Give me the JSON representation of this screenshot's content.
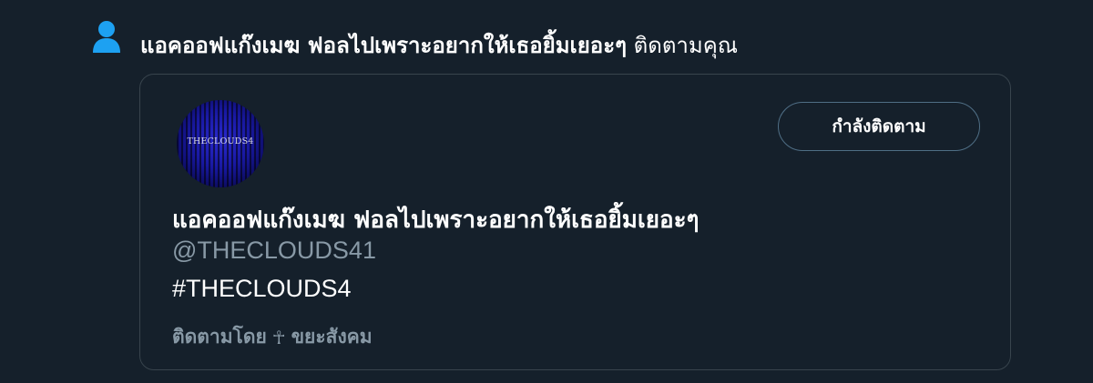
{
  "notification": {
    "icon": "person-icon",
    "actor_name": "แอคออฟแก๊งเมฆ ฟอลไปเพราะอยากให้เธอยิ้มเยอะๆ",
    "action_text": "ติดตามคุณ"
  },
  "user_card": {
    "avatar_text": "THECLOUDS4",
    "follow_button_label": "กำลังติดตาม",
    "display_name": "แอคออฟแก๊งเมฆ ฟอลไปเพราะอยากให้เธอยิ้มเยอะๆ",
    "handle": "@THECLOUDS41",
    "bio": "#THECLOUDS4",
    "followed_by_prefix": "ติดตามโดย",
    "followed_by_symbol": "☥",
    "followed_by_name": "ขยะสังคม"
  },
  "colors": {
    "background": "#15202b",
    "accent": "#1da1f2",
    "muted_text": "#8899a6",
    "border": "#38444d"
  }
}
